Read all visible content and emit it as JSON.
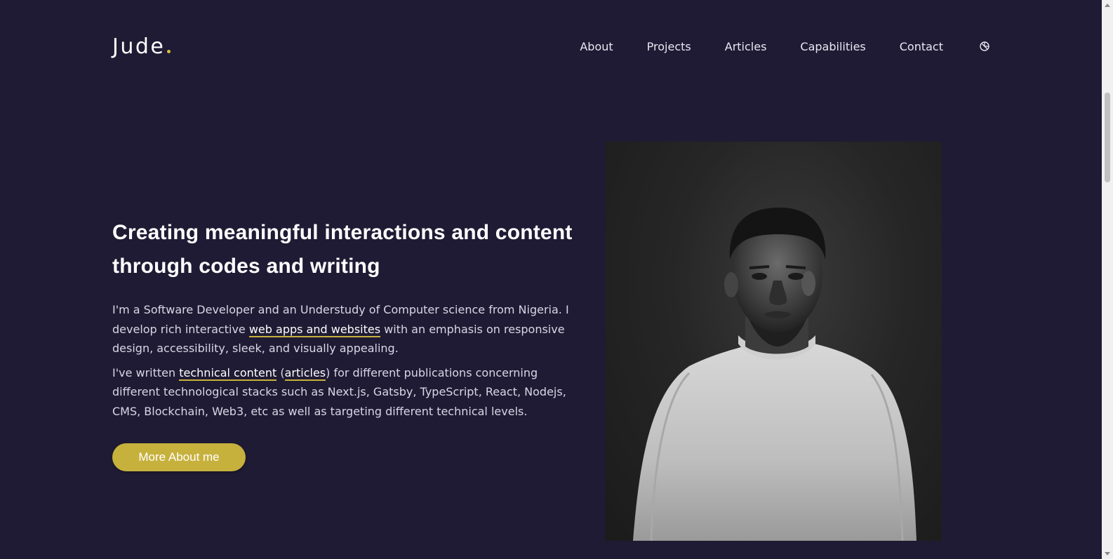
{
  "header": {
    "logo": "Jude",
    "nav": [
      "About",
      "Projects",
      "Articles",
      "Capabilities",
      "Contact"
    ],
    "theme_toggle_icon": "theme-toggle-icon"
  },
  "hero": {
    "headline": "Creating meaningful interactions and content through codes and writing",
    "para1": {
      "before": "I'm a Software Developer and an Understudy of Computer science from Nigeria. I develop rich interactive ",
      "link": "web apps and websites",
      "after": " with an emphasis on responsive design, accessibility, sleek, and visually appealing."
    },
    "para2": {
      "before": "I've written ",
      "link1": "technical content",
      "mid": " (",
      "link2": "articles",
      "after": ") for different publications concerning different technological stacks such as Next.js, Gatsby, TypeScript, React, Nodejs, CMS, Blockchain, Web3, etc as well as targeting different technical levels."
    },
    "cta": "More About me"
  },
  "colors": {
    "background": "#1f1b34",
    "accent": "#c7b13d",
    "text": "#e9e7f2"
  }
}
